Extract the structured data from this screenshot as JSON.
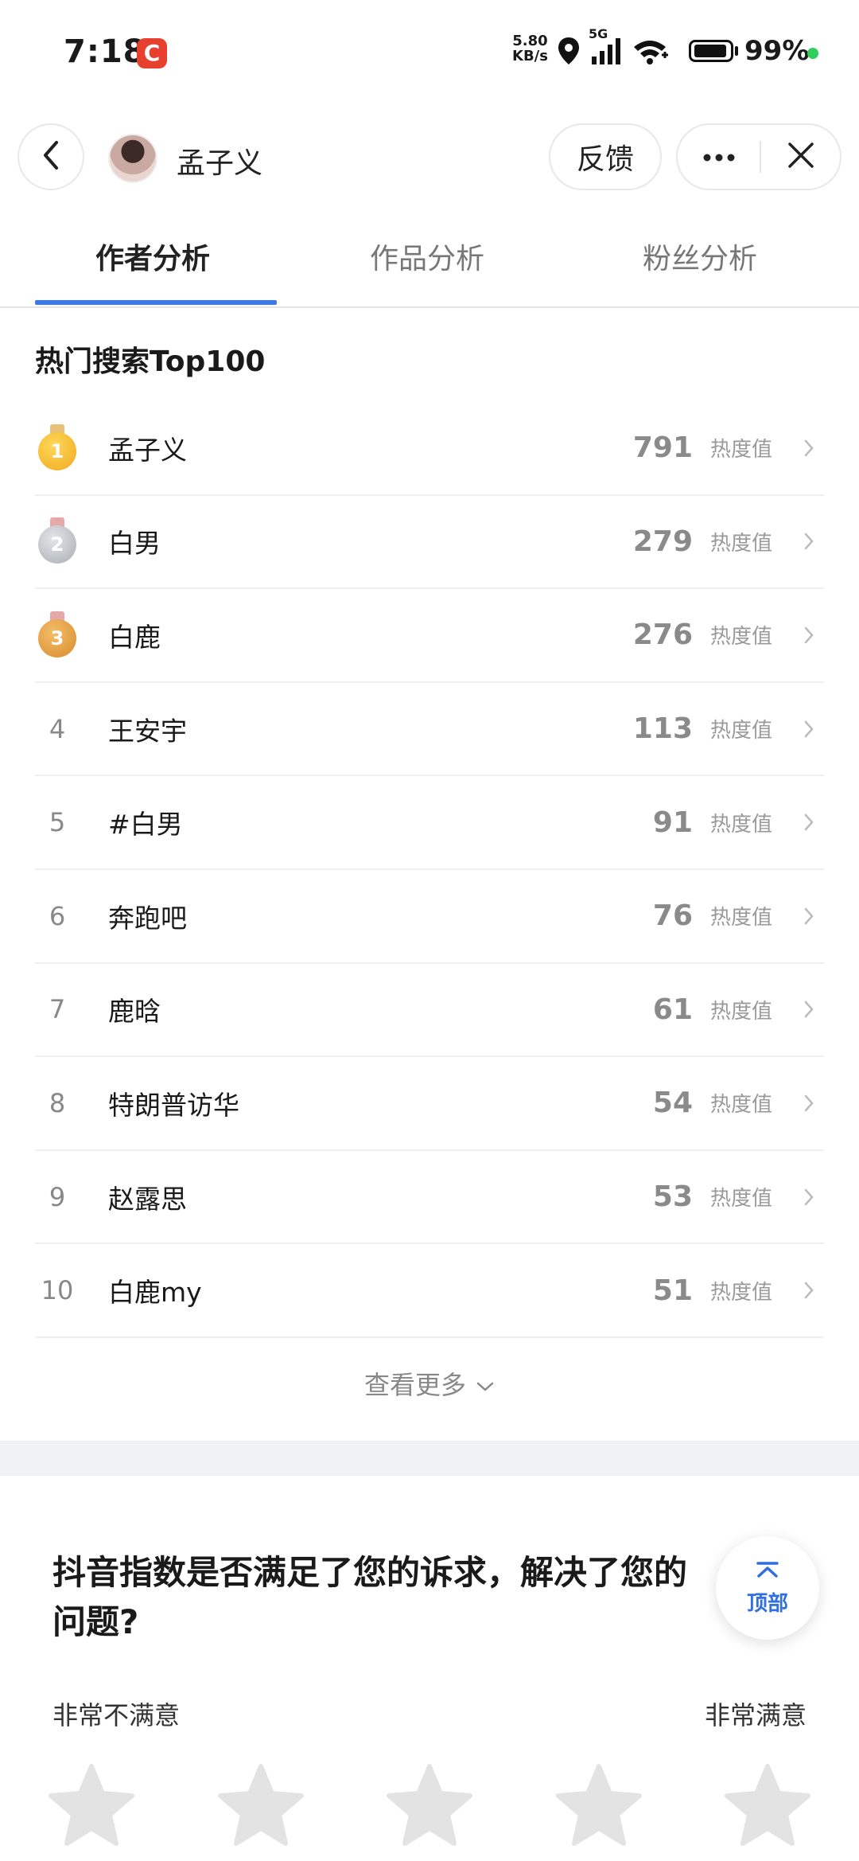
{
  "status_bar": {
    "time": "7:18",
    "app_badge": "C",
    "net_speed_value": "5.80",
    "net_speed_unit": "KB/s",
    "network": "5G",
    "battery": "99%"
  },
  "header": {
    "author_name": "孟子义",
    "feedback_label": "反馈"
  },
  "tabs": [
    {
      "label": "作者分析",
      "active": true
    },
    {
      "label": "作品分析",
      "active": false
    },
    {
      "label": "粉丝分析",
      "active": false
    }
  ],
  "hot_search": {
    "title": "热门搜索Top100",
    "unit_label": "热度值",
    "rows": [
      {
        "rank": "1",
        "keyword": "孟子义",
        "value": "791"
      },
      {
        "rank": "2",
        "keyword": "白男",
        "value": "279"
      },
      {
        "rank": "3",
        "keyword": "白鹿",
        "value": "276"
      },
      {
        "rank": "4",
        "keyword": "王安宇",
        "value": "113"
      },
      {
        "rank": "5",
        "keyword": "#白男",
        "value": "91"
      },
      {
        "rank": "6",
        "keyword": "奔跑吧",
        "value": "76"
      },
      {
        "rank": "7",
        "keyword": "鹿晗",
        "value": "61"
      },
      {
        "rank": "8",
        "keyword": "特朗普访华",
        "value": "54"
      },
      {
        "rank": "9",
        "keyword": "赵露思",
        "value": "53"
      },
      {
        "rank": "10",
        "keyword": "白鹿my",
        "value": "51"
      }
    ],
    "more_label": "查看更多"
  },
  "survey": {
    "question": "抖音指数是否满足了您的诉求，解决了您的",
    "question_line2": "问题?",
    "low_label": "非常不满意",
    "high_label": "非常满意",
    "stars": 5
  },
  "back_to_top": "顶部",
  "colors": {
    "accent": "#3a7bea",
    "gold": "#f5b82e",
    "silver": "#b9bcc2",
    "bronze": "#e0a04a"
  }
}
